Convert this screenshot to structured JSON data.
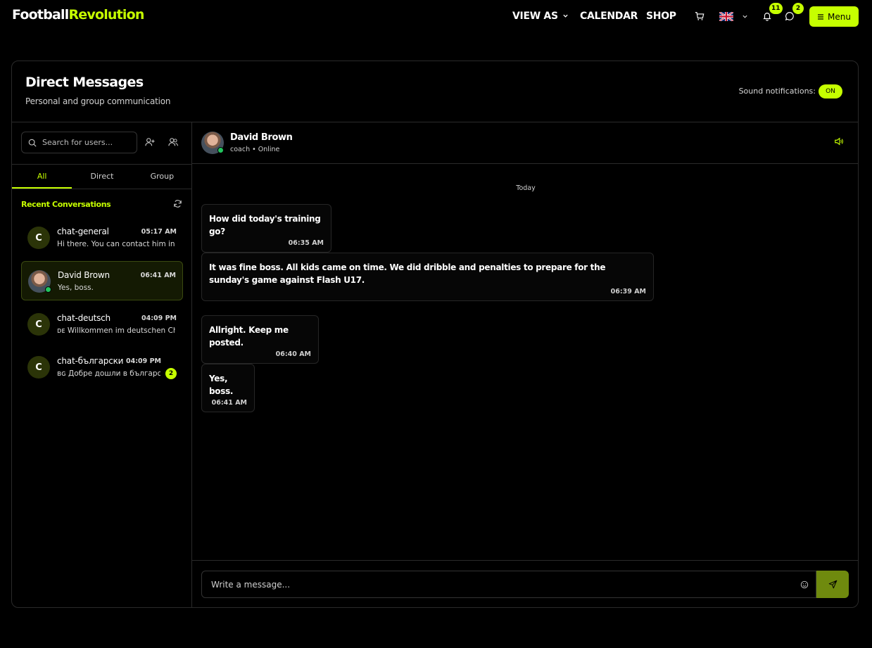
{
  "brand": {
    "part1": "Football",
    "part2": "Revolution"
  },
  "nav": {
    "view_as": "VIEW AS",
    "calendar": "CALENDAR",
    "shop": "SHOP",
    "notifications_count": "11",
    "messages_count": "2",
    "menu_label": "Menu"
  },
  "header": {
    "title": "Direct Messages",
    "subtitle": "Personal and group communication",
    "sound_label": "Sound notifications:",
    "sound_state": "ON"
  },
  "sidebar": {
    "search_placeholder": "Search for users...",
    "tabs": [
      {
        "label": "All",
        "active": true
      },
      {
        "label": "Direct",
        "active": false
      },
      {
        "label": "Group",
        "active": false
      }
    ],
    "recent_label": "Recent Conversations",
    "conversations": [
      {
        "initial": "C",
        "name": "chat-general",
        "time": "05:17 AM",
        "preview": "Hi there. You can contact him inside the group"
      },
      {
        "initial": "",
        "name": "David Brown",
        "time": "06:41 AM",
        "preview": "Yes, boss."
      },
      {
        "initial": "C",
        "name": "chat-deutsch",
        "time": "04:09 PM",
        "preview": "ᴅᴇ Willkommen im deutschen Chat"
      },
      {
        "initial": "C",
        "name": "chat-български",
        "time": "04:09 PM",
        "preview": "ʙɢ Добре дошли в българския чат",
        "unread": "2"
      }
    ]
  },
  "chat": {
    "contact_name": "David Brown",
    "contact_status": "coach • Online",
    "day_label": "Today",
    "messages": [
      {
        "text": "How did today's training go?",
        "time": "06:35 AM"
      },
      {
        "text": "It was fine boss. All kids came on time. We did dribble and penalties to prepare for the sunday's game against Flash U17.",
        "time": "06:39 AM"
      },
      {
        "text": "Allright. Keep me posted.",
        "time": "06:40 AM"
      },
      {
        "text": "Yes, boss.",
        "time": "06:41 AM"
      }
    ],
    "composer_placeholder": "Write a message..."
  },
  "colors": {
    "accent": "#c6ff00",
    "online": "#22c55e",
    "send": "#6f8a0e"
  }
}
